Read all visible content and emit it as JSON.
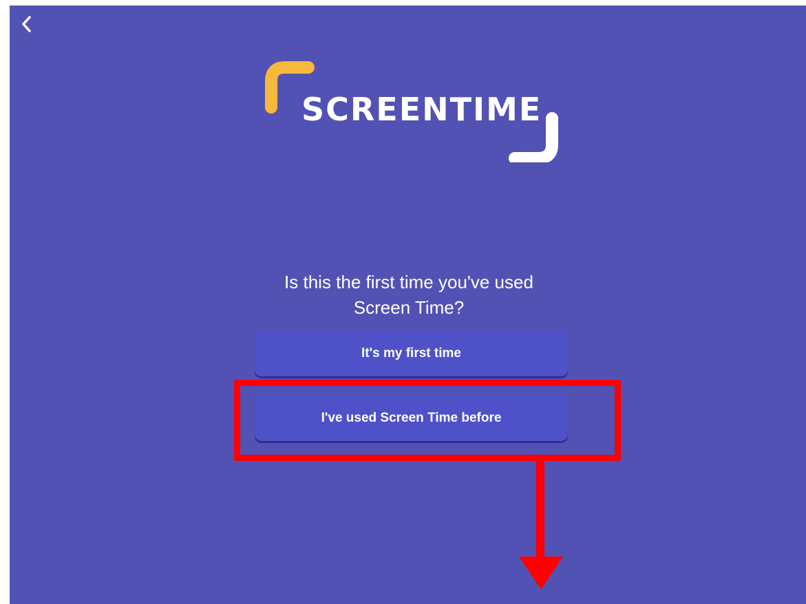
{
  "header": {
    "back_icon": "chevron-left-icon"
  },
  "logo": {
    "text": "SCREENTIME",
    "accent_color": "#f6b93b",
    "bracket_color": "#ffffff"
  },
  "prompt": {
    "line1": "Is this the first time you've used",
    "line2": "Screen Time?"
  },
  "buttons": {
    "first_time_label": "It's my first time",
    "used_before_label": "I've used Screen Time before"
  },
  "annotation": {
    "highlight_color": "#ff0000",
    "arrow_direction": "down"
  },
  "colors": {
    "background": "#5252b4",
    "button": "#4f51c9",
    "text": "#ffffff"
  }
}
